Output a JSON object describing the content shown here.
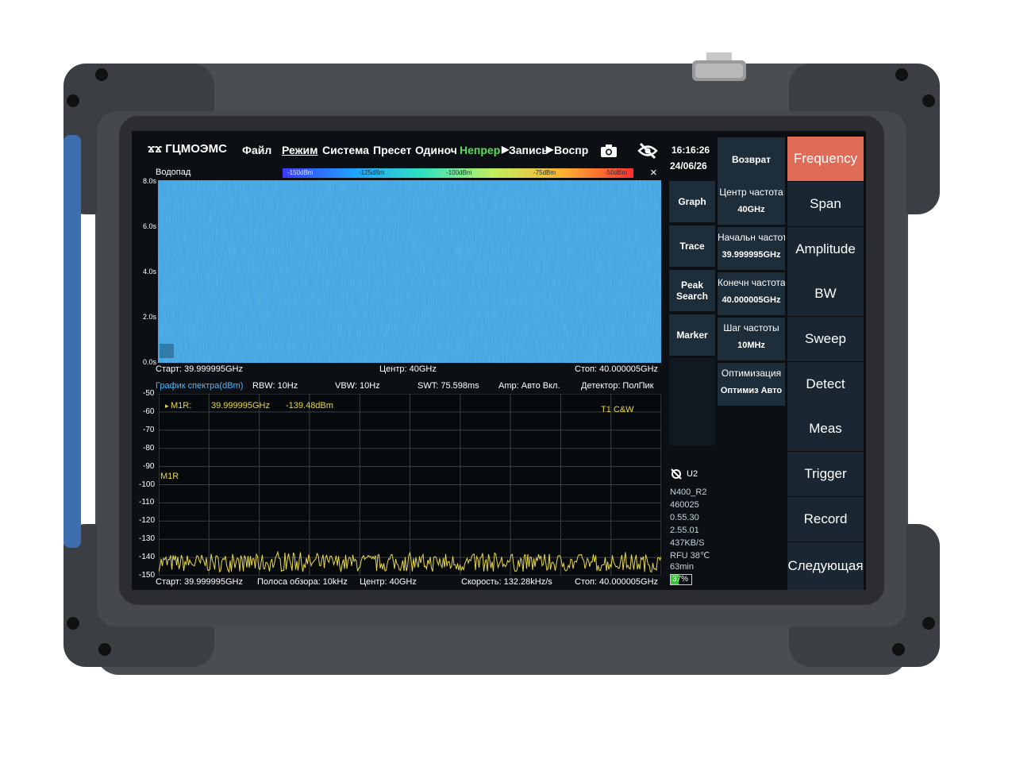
{
  "header": {
    "logo": "ГЦМОЭМС",
    "menu": [
      "Файл",
      "Режим",
      "Система",
      "Пресет",
      "Одиноч",
      "Непрер",
      "Запись",
      "Воспр"
    ],
    "time": "16:16:26",
    "date": "24/06/26"
  },
  "waterfall": {
    "title": "Водопад",
    "scale_labels": [
      "-150dBm",
      "-125dBm",
      "-100dBm",
      "-75dBm",
      "-50dBm"
    ],
    "close": "×",
    "y_labels": [
      "8.0s",
      "6.0s",
      "4.0s",
      "2.0s",
      "0.0s"
    ],
    "start": "Старт: 39.999995GHz",
    "center": "Центр: 40GHz",
    "stop": "Стоп: 40.000005GHz"
  },
  "spectrum": {
    "title": "График спектра(dBm)",
    "rbw": "RBW: 10Hz",
    "vbw": "VBW: 10Hz",
    "swt": "SWT: 75.598ms",
    "amp": "Amp: Авто Вкл.",
    "detector": "Детектор: ПолПик",
    "y_labels": [
      "-50",
      "-60",
      "-70",
      "-80",
      "-90",
      "-100",
      "-110",
      "-120",
      "-130",
      "-140",
      "-150"
    ],
    "marker_label": "M1R:",
    "marker_freq": "39.999995GHz",
    "marker_level": "-139.48dBm",
    "trace_label": "T1  C&W",
    "marker_tag": "M1R",
    "bottom": {
      "start": "Старт: 39.999995GHz",
      "span": "Полоса обзора: 10kHz",
      "center": "Центр: 40GHz",
      "speed": "Скорость: 132.28kHz/s",
      "stop": "Стоп: 40.000005GHz"
    }
  },
  "chart_data": {
    "type": "line",
    "title": "График спектра(dBm)",
    "xlabel": "",
    "ylabel": "",
    "x_range": [
      "39.999995GHz",
      "40.000005GHz"
    ],
    "ylim": [
      -150,
      -50
    ],
    "yticks": [
      -50,
      -60,
      -70,
      -80,
      -90,
      -100,
      -110,
      -120,
      -130,
      -140,
      -150
    ],
    "grid": true,
    "series": [
      {
        "name": "T1  C&W",
        "noise_floor_dbm": -143,
        "noise_range_dbm": [
          -148,
          -137
        ],
        "color": "#e8d84a"
      }
    ],
    "marker": {
      "name": "M1R",
      "x": "39.999995GHz",
      "y": -139.48
    }
  },
  "side_buttons": [
    "Возврат",
    "Graph",
    "Trace",
    "Peak Search",
    "Marker"
  ],
  "params": [
    {
      "label": "Центр частота",
      "value": "40GHz"
    },
    {
      "label": "Начальн частота",
      "value": "39.999995GHz"
    },
    {
      "label": "Конечн частота",
      "value": "40.000005GHz"
    },
    {
      "label": "Шаг частоты",
      "value": "10MHz"
    },
    {
      "label": "Оптимизация",
      "value": "Оптимиз Авто"
    }
  ],
  "main_menu": [
    "Frequency",
    "Span",
    "Amplitude",
    "BW",
    "Sweep",
    "Detect",
    "Meas",
    "Trigger",
    "Record",
    "Следующая"
  ],
  "status": {
    "device": "U2",
    "lines": [
      "N400_R2",
      "460025",
      "0.55.30",
      "2.55.01",
      "437KB/S",
      "RFU 38℃",
      "63min"
    ],
    "battery": "37%"
  },
  "colors": {
    "accent": "#e06b57",
    "trace": "#e8d84a",
    "waterfall": "#3aa0e0",
    "panel": "#1e2d3a"
  },
  "icons": [
    "camera-icon",
    "eye-off-icon",
    "close-icon",
    "signal-off-icon",
    "battery-icon"
  ]
}
